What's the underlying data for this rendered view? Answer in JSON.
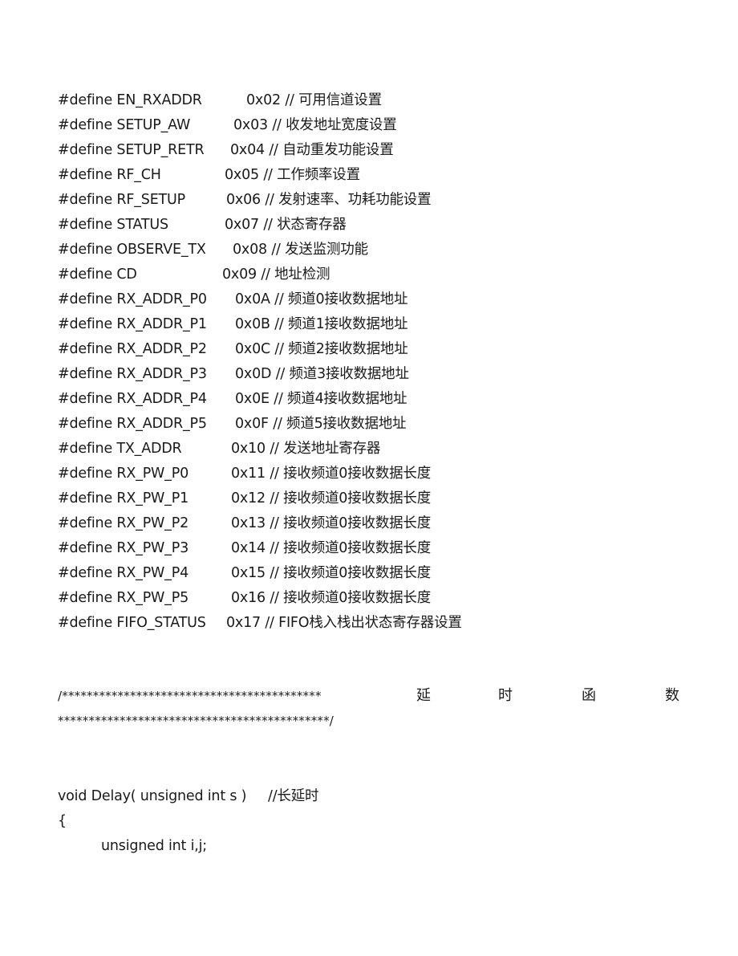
{
  "defines": [
    {
      "keyword": "#define",
      "name": "EN_RXADDR",
      "value": "0x02",
      "comment": "// 可用信道设置"
    },
    {
      "keyword": "#define",
      "name": "SETUP_AW",
      "value": "0x03",
      "comment": "// 收发地址宽度设置"
    },
    {
      "keyword": "#define",
      "name": "SETUP_RETR",
      "value": "0x04",
      "comment": "// 自动重发功能设置"
    },
    {
      "keyword": "#define",
      "name": "RF_CH",
      "value": "0x05",
      "comment": "// 工作频率设置"
    },
    {
      "keyword": "#define",
      "name": "RF_SETUP",
      "value": "0x06",
      "comment": "// 发射速率、功耗功能设置"
    },
    {
      "keyword": "#define",
      "name": "STATUS",
      "value": "0x07",
      "comment": "// 状态寄存器"
    },
    {
      "keyword": "#define",
      "name": "OBSERVE_TX",
      "value": "0x08",
      "comment": "// 发送监测功能"
    },
    {
      "keyword": "#define",
      "name": "CD",
      "value": "0x09",
      "comment": "// 地址检测"
    },
    {
      "keyword": "#define",
      "name": "RX_ADDR_P0",
      "value": "0x0A",
      "comment": "// 频道0接收数据地址"
    },
    {
      "keyword": "#define",
      "name": "RX_ADDR_P1",
      "value": "0x0B",
      "comment": "// 频道1接收数据地址"
    },
    {
      "keyword": "#define",
      "name": "RX_ADDR_P2",
      "value": "0x0C",
      "comment": "// 频道2接收数据地址"
    },
    {
      "keyword": "#define",
      "name": "RX_ADDR_P3",
      "value": "0x0D",
      "comment": "// 频道3接收数据地址"
    },
    {
      "keyword": "#define",
      "name": "RX_ADDR_P4",
      "value": "0x0E",
      "comment": "// 频道4接收数据地址"
    },
    {
      "keyword": "#define",
      "name": "RX_ADDR_P5",
      "value": "0x0F",
      "comment": "// 频道5接收数据地址"
    },
    {
      "keyword": "#define",
      "name": "TX_ADDR",
      "value": "0x10",
      "comment": "// 发送地址寄存器"
    },
    {
      "keyword": "#define",
      "name": "RX_PW_P0",
      "value": "0x11",
      "comment": "// 接收频道0接收数据长度"
    },
    {
      "keyword": "#define",
      "name": "RX_PW_P1",
      "value": "0x12",
      "comment": "// 接收频道0接收数据长度"
    },
    {
      "keyword": "#define",
      "name": "RX_PW_P2",
      "value": "0x13",
      "comment": "// 接收频道0接收数据长度"
    },
    {
      "keyword": "#define",
      "name": "RX_PW_P3",
      "value": "0x14",
      "comment": "// 接收频道0接收数据长度"
    },
    {
      "keyword": "#define",
      "name": "RX_PW_P4",
      "value": "0x15",
      "comment": "// 接收频道0接收数据长度"
    },
    {
      "keyword": "#define",
      "name": "RX_PW_P5",
      "value": "0x16",
      "comment": "// 接收频道0接收数据长度"
    },
    {
      "keyword": "#define",
      "name": "FIFO_STATUS",
      "value": "0x17",
      "comment": "// FIFO栈入栈出状态寄存器设置"
    }
  ],
  "section_banner": {
    "open": "/******************************************",
    "title_chars": [
      "延",
      "时",
      "函",
      "数"
    ],
    "close": "********************************************/"
  },
  "code": {
    "signature": "void Delay( unsigned int s )",
    "signature_comment": "//长延时",
    "open_brace": "{",
    "body_line_1": "unsigned int i,j;"
  }
}
